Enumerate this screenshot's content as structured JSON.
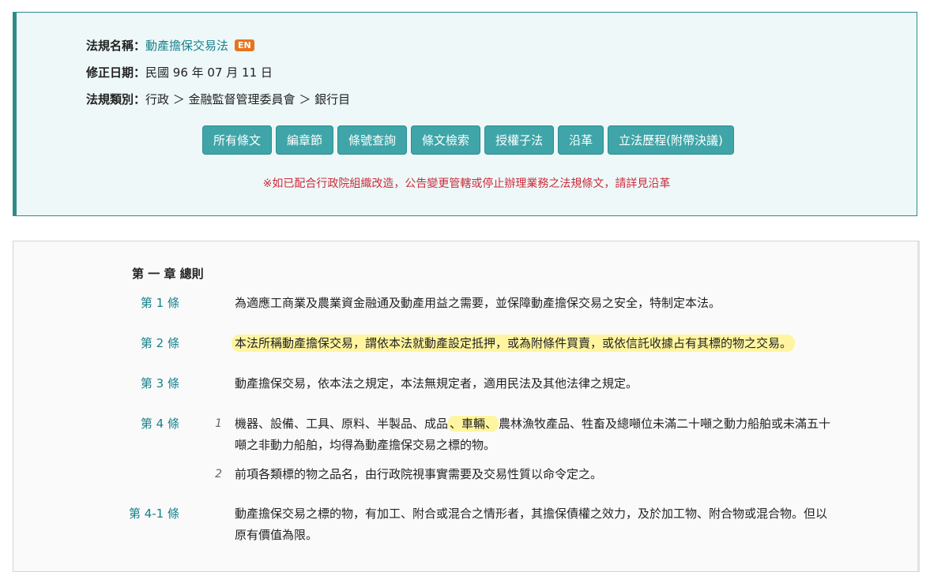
{
  "info": {
    "name_label": "法規名稱：",
    "name_value": "動產擔保交易法",
    "en_badge": "EN",
    "date_label": "修正日期：",
    "date_value": "民國 96 年 07 月 11 日",
    "category_label": "法規類別：",
    "category_value": "行政 ＞ 金融監督管理委員會 ＞ 銀行目"
  },
  "buttons": [
    "所有條文",
    "編章節",
    "條號查詢",
    "條文檢索",
    "授權子法",
    "沿革",
    "立法歷程(附帶決議)"
  ],
  "notice": "※如已配合行政院組織改造，公告變更管轄或停止辦理業務之法規條文，請詳見沿革",
  "chapter_title": "第 一 章 總則",
  "articles": [
    {
      "no": "第 1 條",
      "text": "為適應工商業及農業資金融通及動產用益之需要，並保障動產擔保交易之安全，特制定本法。"
    },
    {
      "no": "第 2 條",
      "text": "本法所稱動產擔保交易，謂依本法就動產設定抵押，或為附條件買賣，或依信託收據占有其標的物之交易。"
    },
    {
      "no": "第 3 條",
      "text": "動產擔保交易，依本法之規定，本法無規定者，適用民法及其他法律之規定。"
    },
    {
      "no": "第 4 條",
      "para1_no": "1",
      "para1_before": "機器、設備、工具、原料、半製品、成品",
      "para1_highlight": "、車輛、",
      "para1_after": "農林漁牧產品、牲畜及總噸位未滿二十噸之動力船舶或未滿五十噸之非動力船舶，均得為動產擔保交易之標的物。",
      "para2_no": "2",
      "para2_text": "前項各類標的物之品名，由行政院視事實需要及交易性質以命令定之。"
    },
    {
      "no": "第 4-1 條",
      "text": "動產擔保交易之標的物，有加工、附合或混合之情形者，其擔保債權之效力，及於加工物、附合物或混合物。但以原有價值為限。"
    }
  ]
}
